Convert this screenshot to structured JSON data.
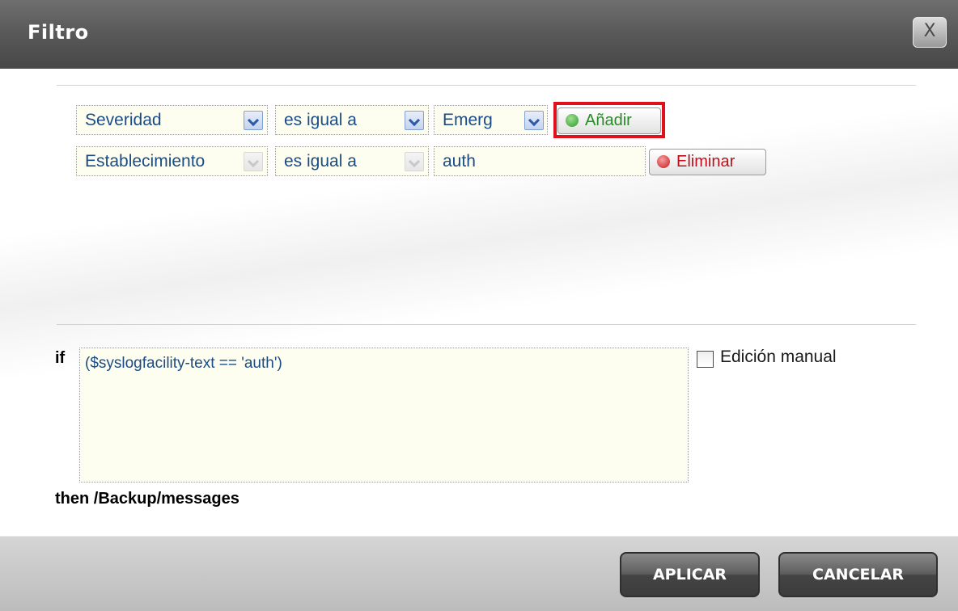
{
  "dialog": {
    "title": "Filtro",
    "close_label": "X"
  },
  "rules": [
    {
      "field": "Severidad",
      "operator": "es igual a",
      "value": "Emerg",
      "action_label": "Añadir",
      "action_icon": "plus-circle-icon"
    },
    {
      "field": "Establecimiento",
      "operator": "es igual a",
      "value": "auth",
      "action_label": "Eliminar",
      "action_icon": "minus-circle-icon"
    }
  ],
  "condition": {
    "if_label": "if",
    "expression": "($syslogfacility-text == 'auth')",
    "manual_edit_label": "Edición manual",
    "manual_edit_checked": false,
    "then_label": "then /Backup/messages"
  },
  "footer": {
    "apply_label": "APLICAR",
    "cancel_label": "CANCELAR"
  },
  "colors": {
    "add_accent": "#2a8a2a",
    "delete_accent": "#c0101c",
    "highlight": "#e0101c",
    "field_text": "#1a4d85"
  }
}
